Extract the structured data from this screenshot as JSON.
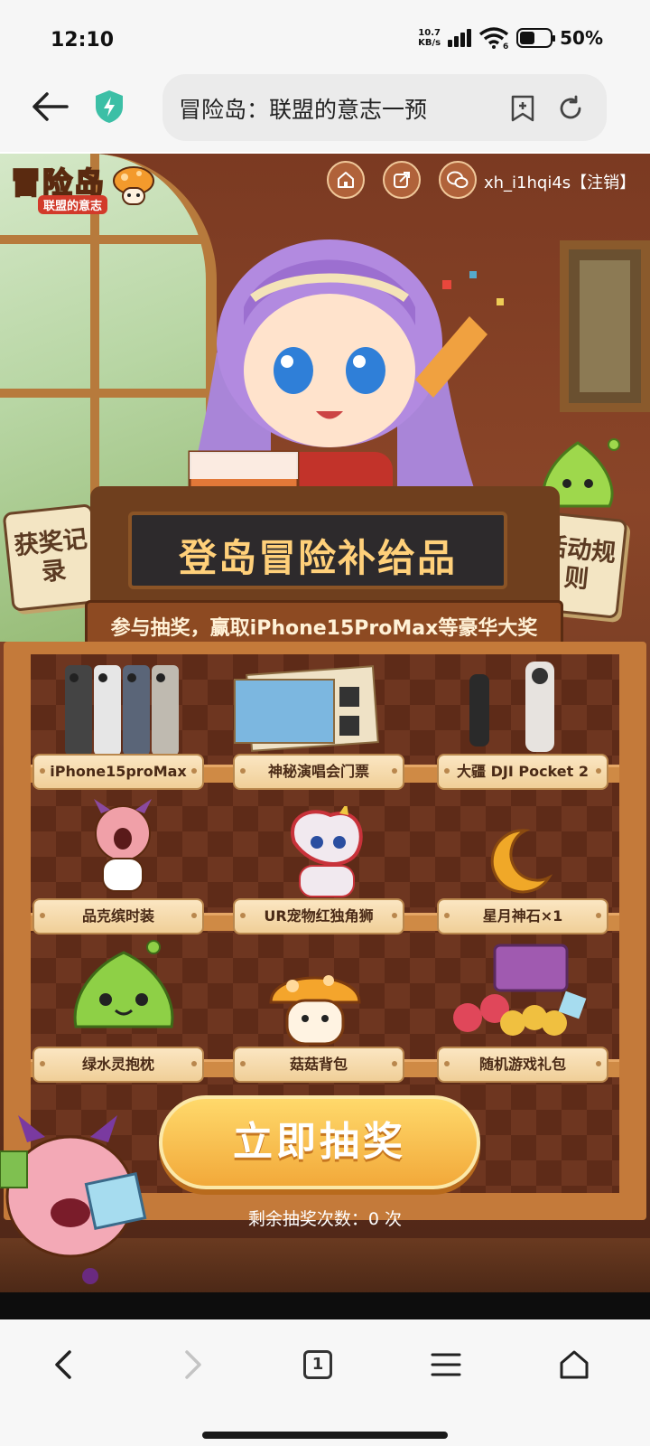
{
  "status_bar": {
    "time": "12:10",
    "net_speed_value": "10.7",
    "net_speed_unit": "KB/s",
    "wifi_label": "6",
    "battery_percent": "50%",
    "battery_level": 0.5
  },
  "browser": {
    "address_text": "冒险岛：联盟的意志一预",
    "icons": [
      "back-arrow-icon",
      "shield-lightning-icon",
      "add-bookmark-icon",
      "reload-icon"
    ]
  },
  "page": {
    "logo_text": "冒险岛",
    "logo_subtitle": "联盟的意志",
    "top_icons": [
      "home-icon",
      "share-icon",
      "wechat-icon"
    ],
    "username_line": "xh_i1hqi4s【注销】",
    "side_tags": {
      "left": "获奖记录",
      "right": "活动规则"
    },
    "banner_title": "登岛冒险补给品",
    "banner_subtitle": "参与抽奖，赢取iPhone15ProMax等豪华大奖",
    "prizes": [
      {
        "label": "iPhone15proMax"
      },
      {
        "label": "神秘演唱会门票"
      },
      {
        "label": "大疆 DJI Pocket 2"
      },
      {
        "label": "品克缤时装"
      },
      {
        "label": "UR宠物红独角狮"
      },
      {
        "label": "星月神石×1"
      },
      {
        "label": "绿水灵抱枕"
      },
      {
        "label": "菇菇背包"
      },
      {
        "label": "随机游戏礼包"
      }
    ],
    "draw_button": "立即抽奖",
    "remaining_text": "剩余抽奖次数：0 次"
  },
  "bottom_nav": {
    "tab_count": "1",
    "icons": [
      "back-icon",
      "forward-icon",
      "tabs-icon",
      "menu-icon",
      "home-icon"
    ]
  },
  "colors": {
    "page_bg": "#7b3a22",
    "shelf_wood": "#c47a3a",
    "label_bg": "#f0cf98",
    "button_gold": "#f2a93a"
  }
}
